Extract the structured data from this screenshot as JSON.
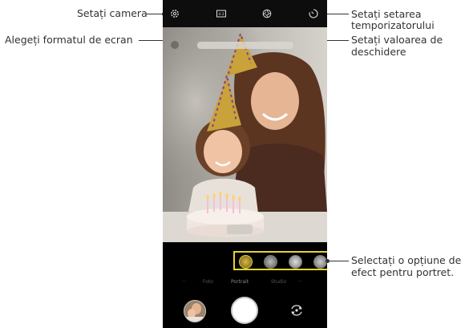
{
  "callouts": {
    "camera_settings": "Setați camera",
    "screen_format": "Alegeți formatul de ecran",
    "timer_1": "Setați setarea",
    "timer_2": "temporizatorului",
    "aperture_1": "Setați valoarea de",
    "aperture_2": "deschidere",
    "portrait_effect_1": "Selectați o opțiune de",
    "portrait_effect_2": "efect pentru portret."
  },
  "camera": {
    "modes": [
      "···",
      "Foto",
      "Portrait",
      "Studio",
      "···"
    ],
    "selected_mode": "Portrait",
    "aspect_label": "4:3"
  },
  "icons": [
    "gear-icon",
    "aspect-ratio-icon",
    "aperture-icon",
    "timer-icon",
    "camera-switch-icon"
  ],
  "colors": {
    "accent": "#e8d230",
    "background": "#000000",
    "text": "#333333"
  }
}
